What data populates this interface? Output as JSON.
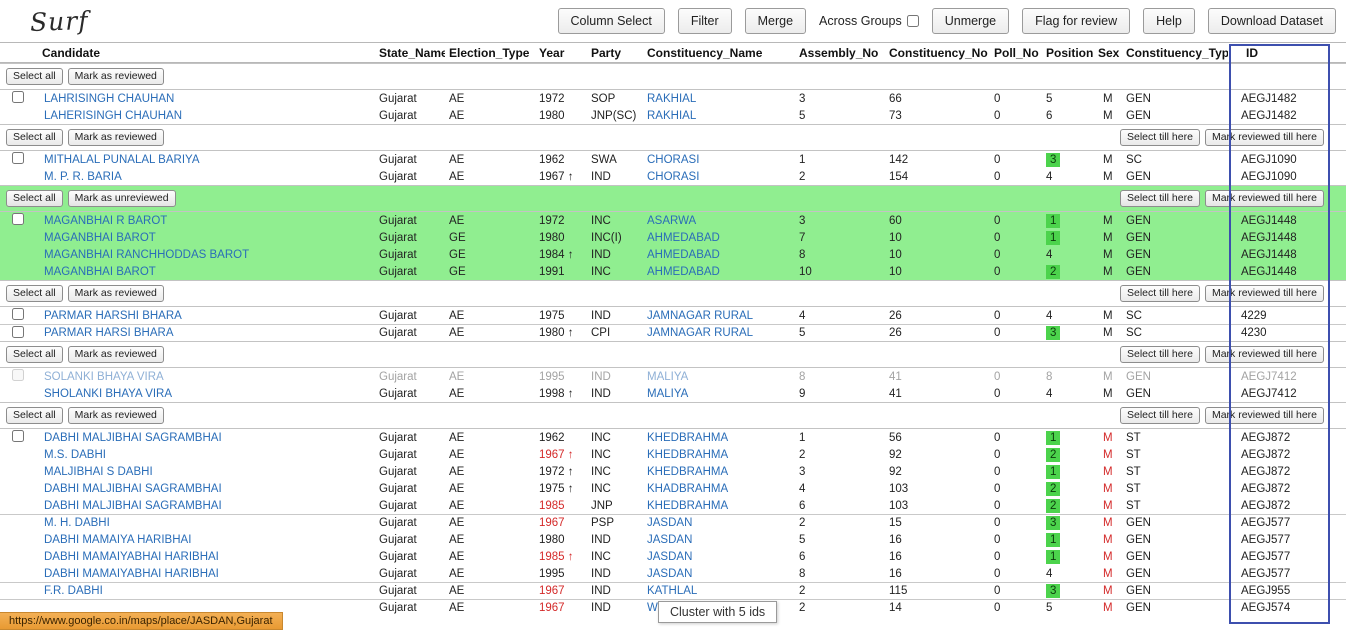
{
  "logo": "Surf",
  "toolbar": {
    "column_select": "Column Select",
    "filter": "Filter",
    "merge": "Merge",
    "across_groups": "Across Groups",
    "unmerge": "Unmerge",
    "flag_for_review": "Flag for review",
    "help": "Help",
    "download_dataset": "Download Dataset"
  },
  "table": {
    "columns": [
      "Candidate",
      "State_Name",
      "Election_Type",
      "Year",
      "Party",
      "Constituency_Name",
      "Assembly_No",
      "Constituency_No",
      "Poll_No",
      "Position",
      "Sex",
      "Constituency_Type",
      "ID"
    ]
  },
  "group_buttons": {
    "select_all": "Select all",
    "select_till": "Select till here",
    "mark_till": "Mark reviewed till here"
  },
  "colors": {
    "cluster_highlight": "#90ee90",
    "position_badge": "#4cd34c",
    "id_column_outline": "#3d4fae",
    "link_blue": "#2a6db8",
    "alert_red": "#d42a2a",
    "statusbar_orange": "#e89a33"
  },
  "groups": [
    {
      "mark_label": "Mark as reviewed",
      "right_buttons": false,
      "highlight": false,
      "rows": [
        {
          "cb": true,
          "name": "LAHRISINGH CHAUHAN",
          "state": "Gujarat",
          "et": "AE",
          "year": "1972",
          "party": "SOP",
          "cons": "RAKHIAL",
          "asm": "3",
          "cno": "66",
          "poll": "0",
          "pos": "5",
          "sex": "M",
          "ct": "GEN",
          "id": "AEGJ1482"
        },
        {
          "name": "LAHERISINGH CHAUHAN",
          "state": "Gujarat",
          "et": "AE",
          "year": "1980",
          "party": "JNP(SC)",
          "cons": "RAKHIAL",
          "asm": "5",
          "cno": "73",
          "poll": "0",
          "pos": "6",
          "sex": "M",
          "ct": "GEN",
          "id": "AEGJ1482"
        }
      ]
    },
    {
      "mark_label": "Mark as reviewed",
      "right_buttons": true,
      "highlight": false,
      "rows": [
        {
          "cb": true,
          "name": "MITHALAL PUNALAL BARIYA",
          "state": "Gujarat",
          "et": "AE",
          "year": "1962",
          "party": "SWA",
          "cons": "CHORASI",
          "asm": "1",
          "cno": "142",
          "poll": "0",
          "pos": "3",
          "pos_g": true,
          "sex": "M",
          "ct": "SC",
          "id": "AEGJ1090"
        },
        {
          "name": "M. P. R. BARIA",
          "state": "Gujarat",
          "et": "AE",
          "year": "1967 ↑",
          "party": "IND",
          "cons": "CHORASI",
          "asm": "2",
          "cno": "154",
          "poll": "0",
          "pos": "4",
          "sex": "M",
          "ct": "GEN",
          "id": "AEGJ1090"
        }
      ]
    },
    {
      "mark_label": "Mark as unreviewed",
      "right_buttons": true,
      "highlight": true,
      "rows": [
        {
          "cb": true,
          "name": "MAGANBHAI R BAROT",
          "state": "Gujarat",
          "et": "AE",
          "year": "1972",
          "party": "INC",
          "cons": "ASARWA",
          "asm": "3",
          "cno": "60",
          "poll": "0",
          "pos": "1",
          "pos_g": true,
          "sex": "M",
          "ct": "GEN",
          "id": "AEGJ1448"
        },
        {
          "name": "MAGANBHAI BAROT",
          "state": "Gujarat",
          "et": "GE",
          "year": "1980",
          "party": "INC(I)",
          "cons": "AHMEDABAD",
          "asm": "7",
          "cno": "10",
          "poll": "0",
          "pos": "1",
          "pos_g": true,
          "sex": "M",
          "ct": "GEN",
          "id": "AEGJ1448"
        },
        {
          "name": "MAGANBHAI RANCHHODDAS BAROT",
          "state": "Gujarat",
          "et": "GE",
          "year": "1984 ↑",
          "party": "IND",
          "cons": "AHMEDABAD",
          "asm": "8",
          "cno": "10",
          "poll": "0",
          "pos": "4",
          "sex": "M",
          "ct": "GEN",
          "id": "AEGJ1448"
        },
        {
          "name": "MAGANBHAI BAROT",
          "state": "Gujarat",
          "et": "GE",
          "year": "1991",
          "party": "INC",
          "cons": "AHMEDABAD",
          "asm": "10",
          "cno": "10",
          "poll": "0",
          "pos": "2",
          "pos_g": true,
          "sex": "M",
          "ct": "GEN",
          "id": "AEGJ1448"
        }
      ]
    },
    {
      "mark_label": "Mark as reviewed",
      "right_buttons": true,
      "highlight": false,
      "rows": [
        {
          "cb": true,
          "name": "PARMAR HARSHI BHARA",
          "state": "Gujarat",
          "et": "AE",
          "year": "1975",
          "party": "IND",
          "cons": "JAMNAGAR RURAL",
          "asm": "4",
          "cno": "26",
          "poll": "0",
          "pos": "4",
          "sex": "M",
          "ct": "SC",
          "id": "4229"
        },
        {
          "cb": true,
          "sep": true,
          "name": "PARMAR HARSI BHARA",
          "state": "Gujarat",
          "et": "AE",
          "year": "1980 ↑",
          "party": "CPI",
          "cons": "JAMNAGAR RURAL",
          "asm": "5",
          "cno": "26",
          "poll": "0",
          "pos": "3",
          "pos_g": true,
          "sex": "M",
          "ct": "SC",
          "id": "4230"
        }
      ]
    },
    {
      "mark_label": "Mark as reviewed",
      "right_buttons": true,
      "highlight": false,
      "rows": [
        {
          "cb": true,
          "muted": true,
          "name": "SOLANKI BHAYA VIRA",
          "state": "Gujarat",
          "et": "AE",
          "year": "1995",
          "party": "IND",
          "cons": "MALIYA",
          "asm": "8",
          "cno": "41",
          "poll": "0",
          "pos": "8",
          "sex": "M",
          "ct": "GEN",
          "id": "AEGJ7412"
        },
        {
          "name": "SHOLANKI BHAYA VIRA",
          "state": "Gujarat",
          "et": "AE",
          "year": "1998 ↑",
          "party": "IND",
          "cons": "MALIYA",
          "asm": "9",
          "cno": "41",
          "poll": "0",
          "pos": "4",
          "sex": "M",
          "ct": "GEN",
          "id": "AEGJ7412"
        }
      ]
    },
    {
      "mark_label": "Mark as reviewed",
      "right_buttons": true,
      "highlight": false,
      "rows": [
        {
          "cb": true,
          "name": "DABHI MALJIBHAI SAGRAMBHAI",
          "state": "Gujarat",
          "et": "AE",
          "year": "1962",
          "party": "INC",
          "cons": "KHEDBRAHMA",
          "asm": "1",
          "cno": "56",
          "poll": "0",
          "pos": "1",
          "pos_g": true,
          "sex": "M",
          "sex_r": true,
          "ct": "ST",
          "id": "AEGJ872"
        },
        {
          "name": "M.S. DABHI",
          "state": "Gujarat",
          "et": "AE",
          "year": "1967 ↑",
          "yr_red": true,
          "party": "INC",
          "cons": "KHEDBRAHMA",
          "asm": "2",
          "cno": "92",
          "poll": "0",
          "pos": "2",
          "pos_g": true,
          "sex": "M",
          "sex_r": true,
          "ct": "ST",
          "id": "AEGJ872"
        },
        {
          "name": "MALJIBHAI S DABHI",
          "state": "Gujarat",
          "et": "AE",
          "year": "1972 ↑",
          "party": "INC",
          "cons": "KHEDBRAHMA",
          "asm": "3",
          "cno": "92",
          "poll": "0",
          "pos": "1",
          "pos_g": true,
          "sex": "M",
          "sex_r": true,
          "ct": "ST",
          "id": "AEGJ872"
        },
        {
          "name": "DABHI MALJIBHAI SAGRAMBHAI",
          "state": "Gujarat",
          "et": "AE",
          "year": "1975 ↑",
          "party": "INC",
          "cons": "KHADBRAHMA",
          "asm": "4",
          "cno": "103",
          "poll": "0",
          "pos": "2",
          "pos_g": true,
          "sex": "M",
          "sex_r": true,
          "ct": "ST",
          "id": "AEGJ872"
        },
        {
          "name": "DABHI MALJIBHAI SAGRAMBHAI",
          "state": "Gujarat",
          "et": "AE",
          "year": "1985",
          "yr_red": true,
          "party": "JNP",
          "cons": "KHEDBRAHMA",
          "asm": "6",
          "cno": "103",
          "poll": "0",
          "pos": "2",
          "pos_g": true,
          "sex": "M",
          "sex_r": true,
          "ct": "ST",
          "id": "AEGJ872"
        },
        {
          "sep": true,
          "name": "M. H. DABHI",
          "state": "Gujarat",
          "et": "AE",
          "year": "1967",
          "yr_red": true,
          "party": "PSP",
          "cons": "JASDAN",
          "asm": "2",
          "cno": "15",
          "poll": "0",
          "pos": "3",
          "pos_g": true,
          "sex": "M",
          "sex_r": true,
          "ct": "GEN",
          "id": "AEGJ577"
        },
        {
          "name": "DABHI MAMAIYA HARIBHAI",
          "state": "Gujarat",
          "et": "AE",
          "year": "1980",
          "party": "IND",
          "cons": "JASDAN",
          "asm": "5",
          "cno": "16",
          "poll": "0",
          "pos": "1",
          "pos_g": true,
          "sex": "M",
          "sex_r": true,
          "ct": "GEN",
          "id": "AEGJ577"
        },
        {
          "name": "DABHI MAMAIYABHAI HARIBHAI",
          "state": "Gujarat",
          "et": "AE",
          "year": "1985 ↑",
          "yr_red": true,
          "party": "INC",
          "cons": "JASDAN",
          "asm": "6",
          "cno": "16",
          "poll": "0",
          "pos": "1",
          "pos_g": true,
          "sex": "M",
          "sex_r": true,
          "ct": "GEN",
          "id": "AEGJ577"
        },
        {
          "name": "DABHI MAMAIYABHAI HARIBHAI",
          "state": "Gujarat",
          "et": "AE",
          "year": "1995",
          "party": "IND",
          "cons": "JASDAN",
          "asm": "8",
          "cno": "16",
          "poll": "0",
          "pos": "4",
          "sex": "M",
          "sex_r": true,
          "ct": "GEN",
          "id": "AEGJ577"
        },
        {
          "sep": true,
          "name": "F.R. DABHI",
          "state": "Gujarat",
          "et": "AE",
          "year": "1967",
          "yr_red": true,
          "party": "IND",
          "cons": "KATHLAL",
          "asm": "2",
          "cno": "115",
          "poll": "0",
          "pos": "3",
          "pos_g": true,
          "sex": "M",
          "sex_r": true,
          "ct": "GEN",
          "id": "AEGJ955"
        },
        {
          "sep": true,
          "name": "",
          "state": "Gujarat",
          "et": "AE",
          "year": "1967",
          "yr_red": true,
          "party": "IND",
          "cons": "W",
          "asm": "2",
          "cno": "14",
          "poll": "0",
          "poll_mark": true,
          "pos": "5",
          "sex": "M",
          "sex_r": true,
          "ct": "GEN",
          "id": "AEGJ574"
        }
      ]
    }
  ],
  "tooltip": "Cluster with 5 ids",
  "status_url": "https://www.google.co.in/maps/place/JASDAN,Gujarat"
}
